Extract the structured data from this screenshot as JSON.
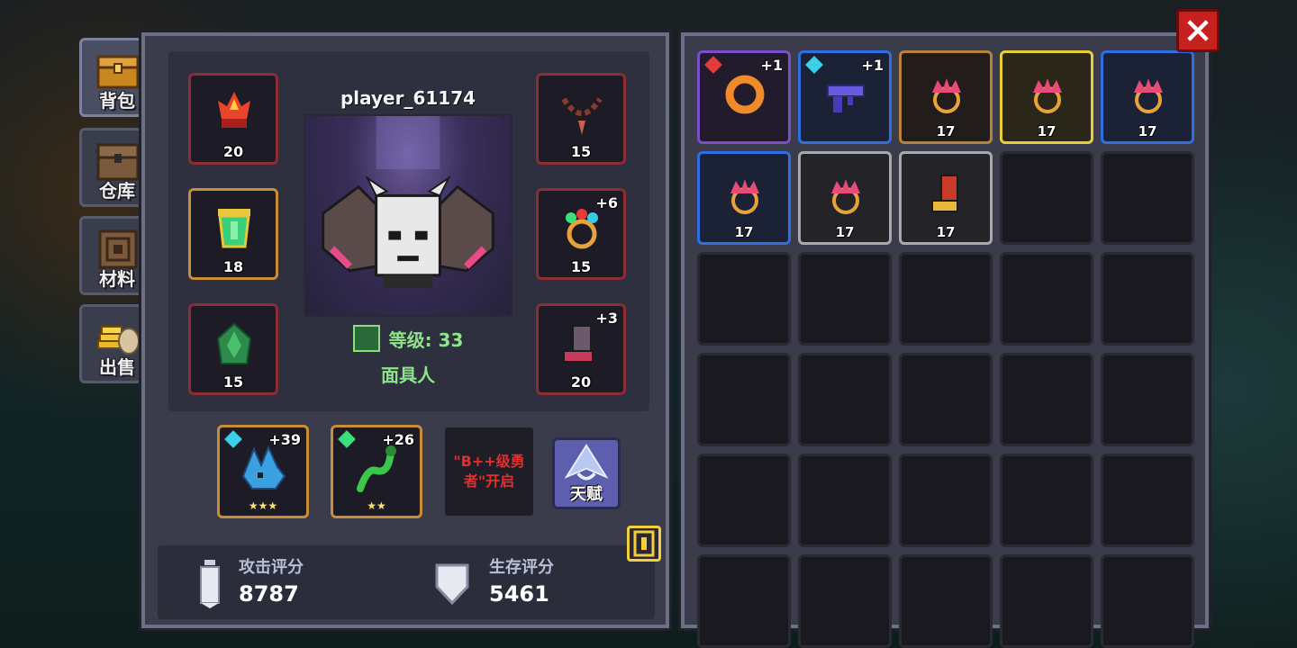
{
  "side_tabs": [
    {
      "label": "背包",
      "icon": "chest-icon",
      "active": true
    },
    {
      "label": "仓库",
      "icon": "storage-chest-icon",
      "active": false
    },
    {
      "label": "材料",
      "icon": "material-crate-icon",
      "active": false
    },
    {
      "label": "出售",
      "icon": "gold-coins-icon",
      "active": false
    }
  ],
  "character": {
    "player_name": "player_61174",
    "level_label": "等级: 33",
    "class_name": "面具人"
  },
  "equipment_left": [
    {
      "level": "20",
      "icon": "flame-crown-icon",
      "border": "red"
    },
    {
      "level": "18",
      "icon": "green-armor-icon",
      "border": "gold"
    },
    {
      "level": "15",
      "icon": "green-cloak-icon",
      "border": "red"
    }
  ],
  "equipment_right": [
    {
      "level": "15",
      "icon": "bead-necklace-icon",
      "plus": ""
    },
    {
      "level": "15",
      "icon": "gem-ring-icon",
      "plus": "+6"
    },
    {
      "level": "20",
      "icon": "boots-icon",
      "plus": "+3"
    }
  ],
  "pets": [
    {
      "plus": "+39",
      "stars": "★★★",
      "icon": "blue-dragon-icon"
    },
    {
      "plus": "+26",
      "stars": "★★",
      "icon": "green-serpent-icon"
    }
  ],
  "locked_slot": {
    "line1": "\"B++级勇",
    "line2": "者\"开启"
  },
  "talent": {
    "label": "天赋"
  },
  "scores": {
    "attack_label": "攻击评分",
    "attack_value": "8787",
    "survival_label": "生存评分",
    "survival_value": "5461"
  },
  "inventory": [
    {
      "icon": "orange-donut-ring-icon",
      "rarity": "purple",
      "plus": "+1",
      "level": "",
      "gem": "#e33a3a"
    },
    {
      "icon": "purple-smg-icon",
      "rarity": "blue",
      "plus": "+1",
      "level": "",
      "gem": "#3ad0e8"
    },
    {
      "icon": "pink-crown-ring-icon",
      "rarity": "gold",
      "plus": "",
      "level": "17",
      "gem": ""
    },
    {
      "icon": "pink-crown-ring-icon",
      "rarity": "yellow",
      "plus": "",
      "level": "17",
      "gem": ""
    },
    {
      "icon": "pink-crown-ring-icon",
      "rarity": "blue",
      "plus": "",
      "level": "17",
      "gem": ""
    },
    {
      "icon": "pink-crown-ring-icon",
      "rarity": "blue",
      "plus": "",
      "level": "17",
      "gem": ""
    },
    {
      "icon": "pink-crown-ring-icon",
      "rarity": "white",
      "plus": "",
      "level": "17",
      "gem": ""
    },
    {
      "icon": "red-boot-icon",
      "rarity": "white",
      "plus": "",
      "level": "17",
      "gem": ""
    }
  ],
  "colors": {
    "panel": "#3a3c4c",
    "level_green": "#8fe38a",
    "close_red": "#c7211f",
    "locked_red": "#e0302e"
  }
}
